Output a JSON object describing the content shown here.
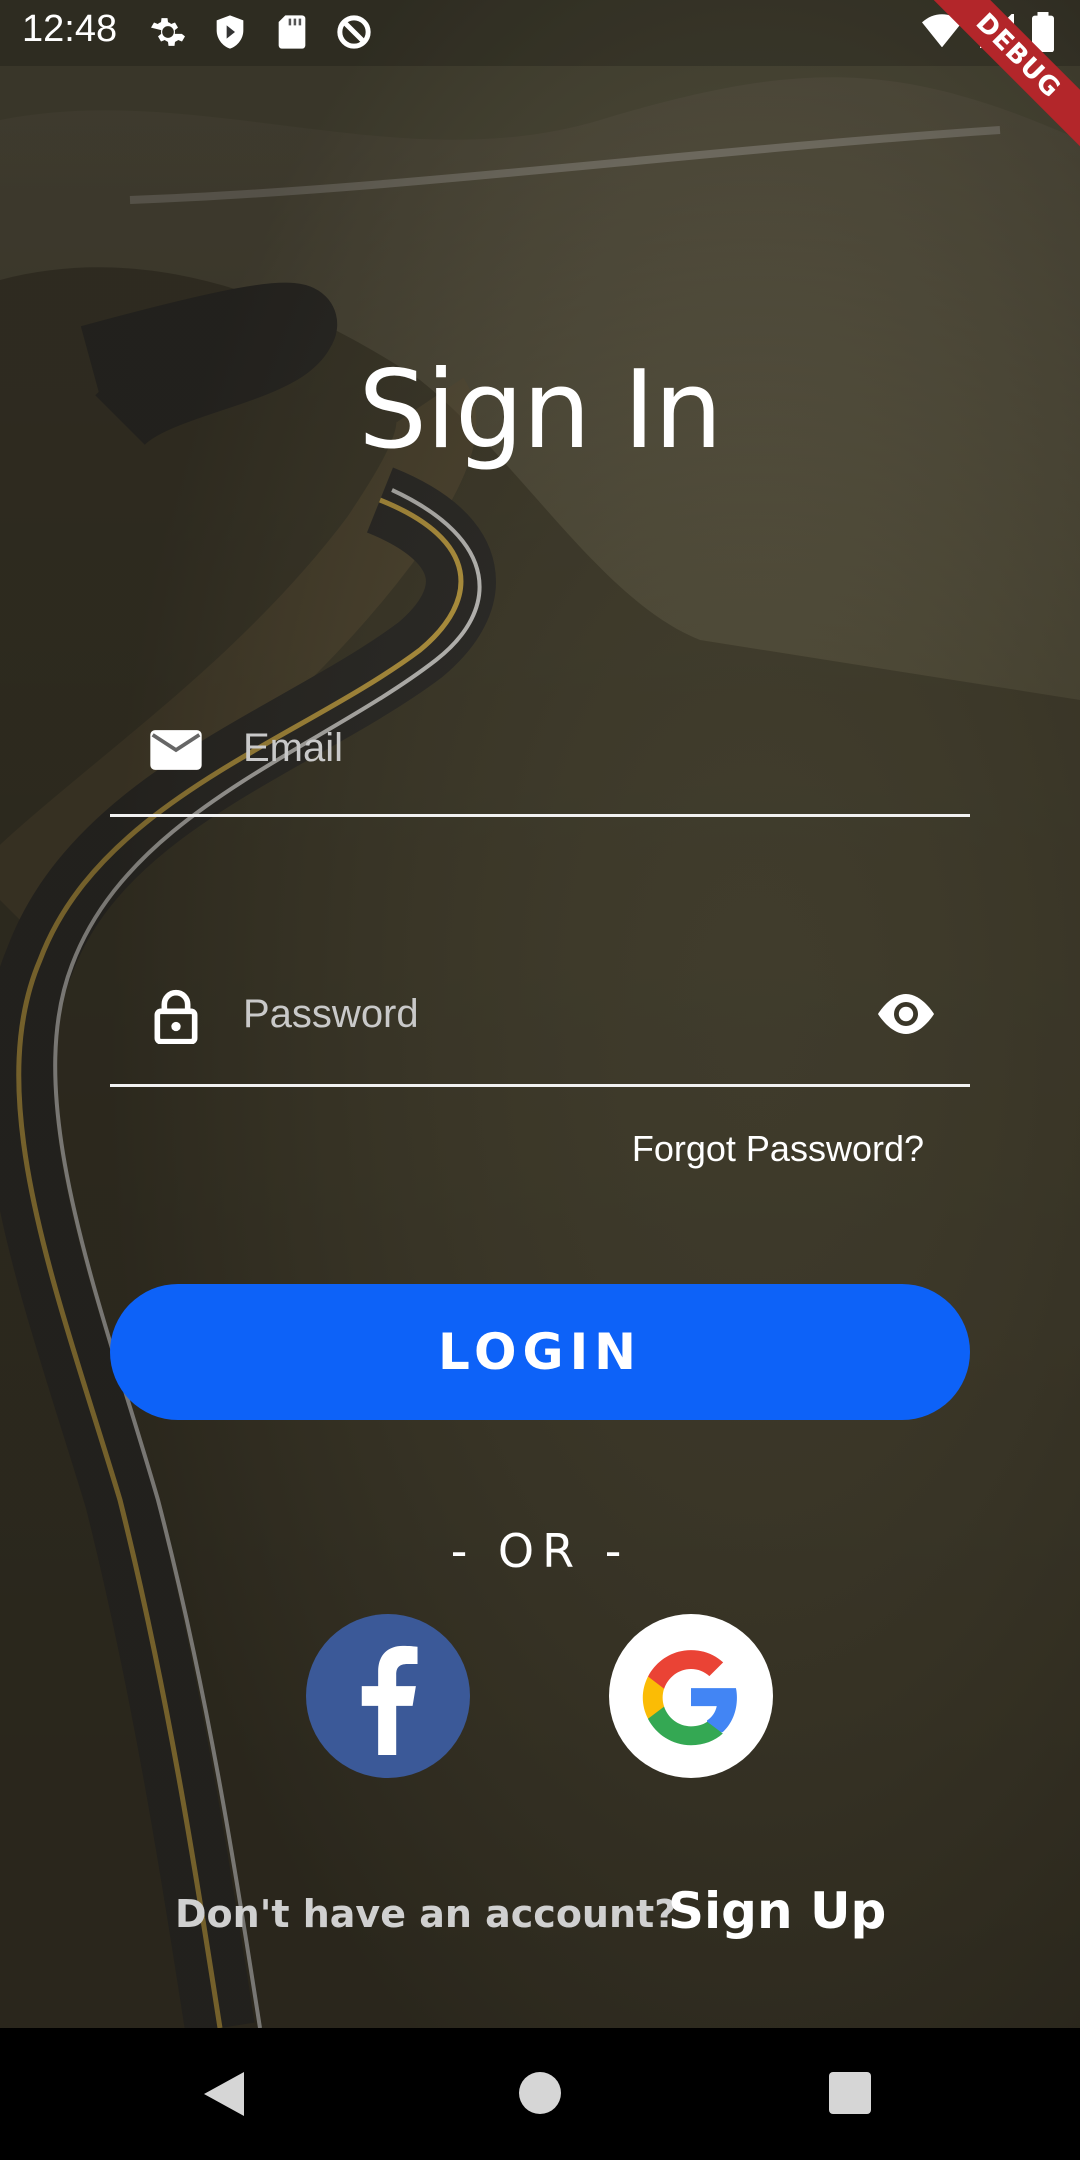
{
  "status_bar": {
    "time": "12:48",
    "icons": [
      "gear-icon",
      "shield-icon",
      "sd-card-icon",
      "no-sync-icon"
    ],
    "right_icons": [
      "wifi-icon",
      "signal-icon",
      "battery-icon"
    ],
    "debug_label": "DEBUG"
  },
  "title": "Sign In",
  "email": {
    "placeholder": "Email",
    "icon": "mail-icon"
  },
  "password": {
    "placeholder": "Password",
    "icon": "lock-icon",
    "toggle_icon": "eye-icon"
  },
  "forgot_password": "Forgot Password?",
  "login_button": "LOGIN",
  "or_text": "- OR -",
  "social": {
    "facebook": {
      "icon": "facebook-icon",
      "color": "#3b5998"
    },
    "google": {
      "icon": "google-icon",
      "color": "#ffffff"
    }
  },
  "signup": {
    "prompt": "Don't have an account?",
    "link": "Sign Up"
  },
  "colors": {
    "primary": "#0d62f8",
    "text": "#ffffff",
    "placeholder": "#c9c9c9"
  },
  "nav_bar": {
    "icons": [
      "back-icon",
      "home-icon",
      "recents-icon"
    ]
  }
}
